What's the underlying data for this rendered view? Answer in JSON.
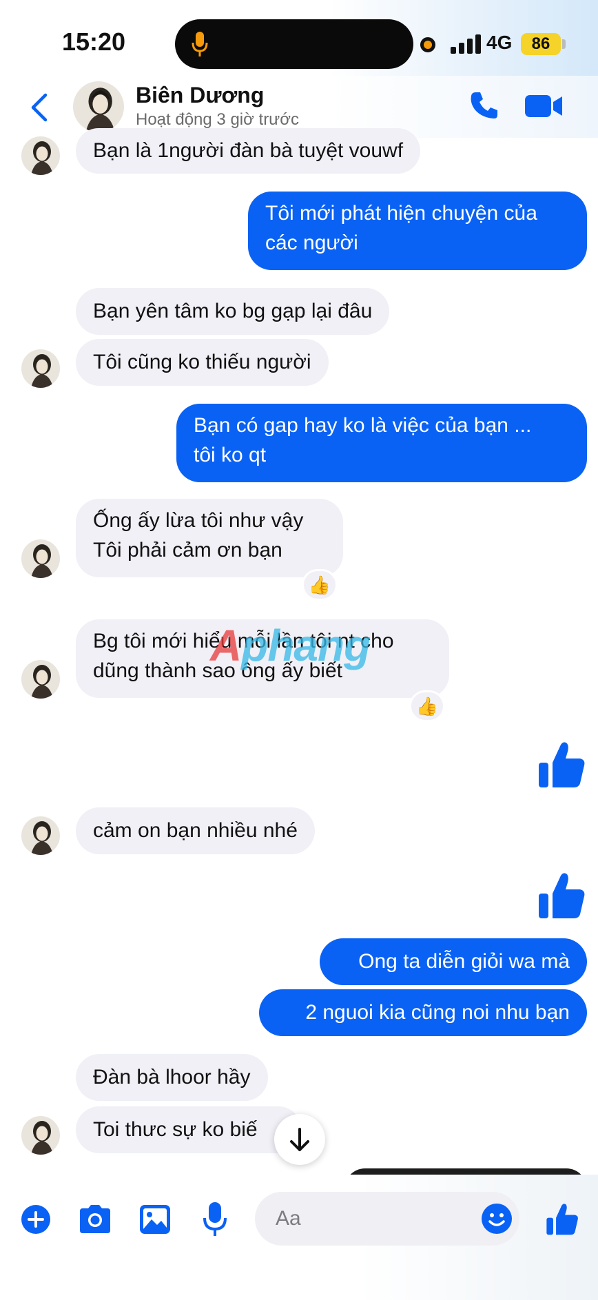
{
  "status_bar": {
    "time": "15:20",
    "network": "4G",
    "battery": "86"
  },
  "header": {
    "name": "Biên Dương",
    "status": "Hoạt động 3 giờ trước"
  },
  "messages": [
    {
      "from": "them",
      "text": "Bạn là 1người đàn bà tuyệt vouwf"
    },
    {
      "from": "me",
      "lines": [
        "Tôi mới phát hiện chuyện của",
        "các người"
      ]
    },
    {
      "from": "them",
      "text": "Bạn yên tâm ko bg gạp lại đâu"
    },
    {
      "from": "them",
      "text": "Tôi cũng ko thiếu người"
    },
    {
      "from": "me",
      "lines": [
        "Bạn có gap hay ko là việc của bạn ...",
        "tôi ko qt"
      ]
    },
    {
      "from": "them",
      "lines": [
        "Ống ấy lừa tôi như vậy",
        "Tôi phải cảm ơn bạn"
      ],
      "reaction": "👍"
    },
    {
      "from": "them",
      "lines": [
        "Bg tôi mới hiểu mỗi lần tôi nt cho",
        "dũng thành sao ông ấy biết"
      ],
      "reaction": "👍"
    },
    {
      "from": "me",
      "sticker": "like"
    },
    {
      "from": "them",
      "text": "cảm on bạn nhiều nhé"
    },
    {
      "from": "me",
      "sticker": "like"
    },
    {
      "from": "me",
      "text": "Ong ta diễn giỏi wa mà"
    },
    {
      "from": "me",
      "text": "2 nguoi kia cũng noi nhu bạn"
    },
    {
      "from": "them",
      "text": "Đàn bà lhoor hầy"
    },
    {
      "from": "them",
      "text": "Toi thưc sự ko biế"
    }
  ],
  "watermark": {
    "part1": "A",
    "part2": "phang"
  },
  "composer": {
    "placeholder": "Aa"
  },
  "colors": {
    "accent": "#0a62f4",
    "incoming_bg": "#f0f0f6"
  }
}
